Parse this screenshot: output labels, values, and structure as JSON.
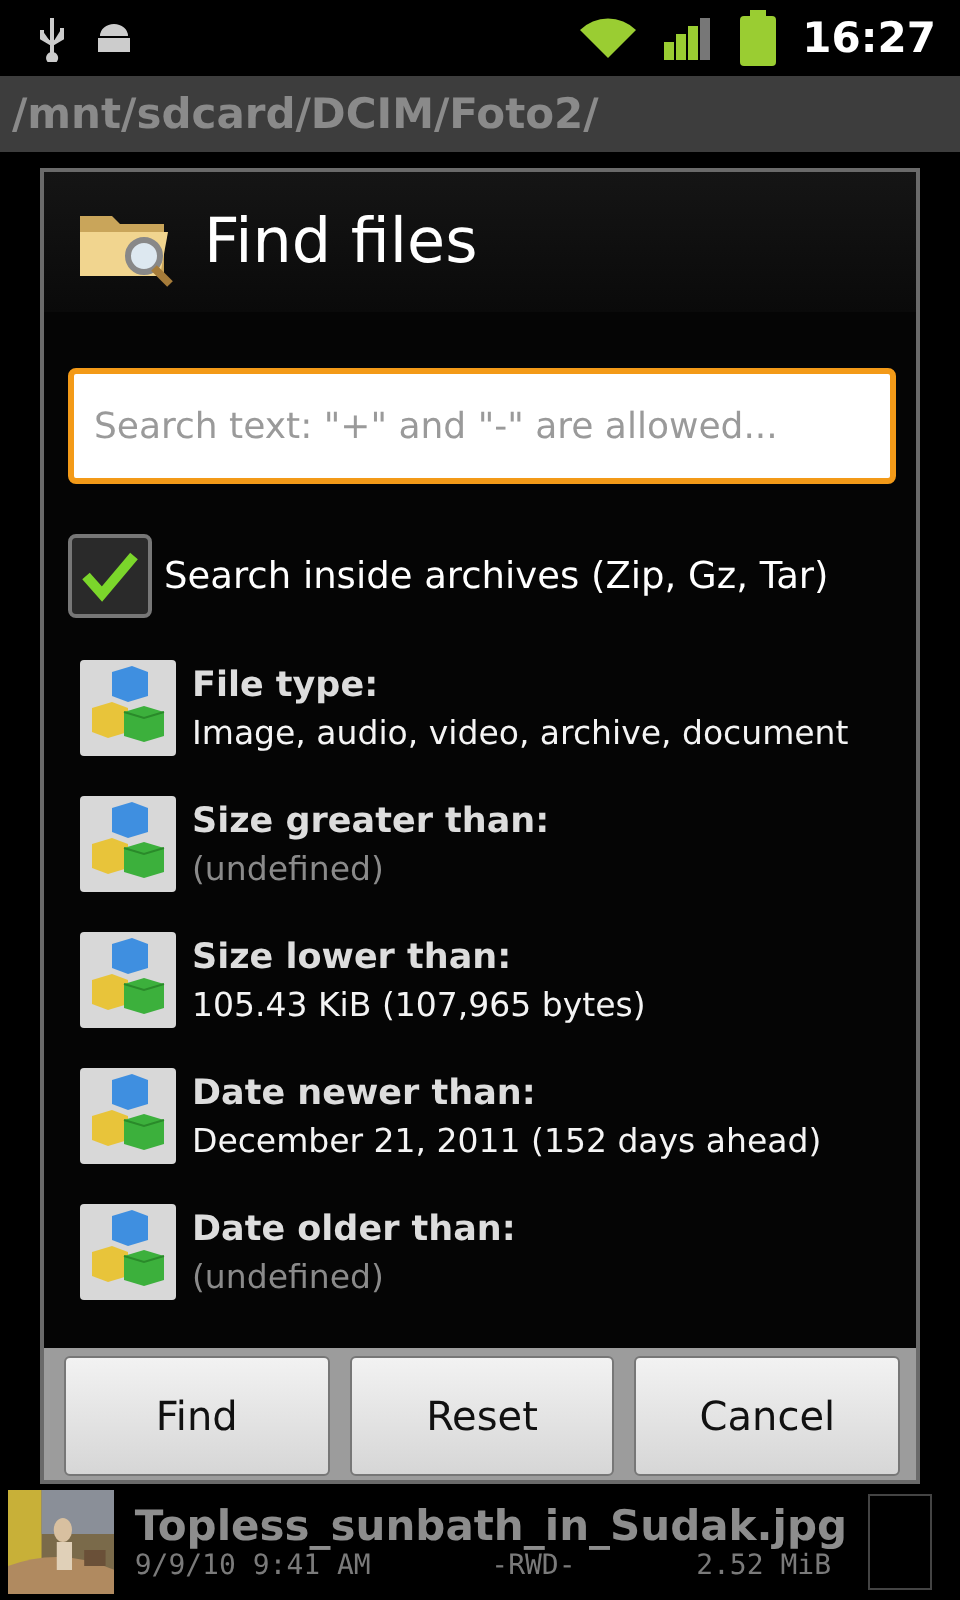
{
  "status_bar": {
    "time": "16:27"
  },
  "path": "/mnt/sdcard/DCIM/Foto2/",
  "dialog": {
    "title": "Find files",
    "search": {
      "placeholder": "Search text: \"+\" and \"-\" are allowed..."
    },
    "archives": {
      "label": "Search inside archives (Zip, Gz, Tar)",
      "checked": true
    },
    "criteria": [
      {
        "label": "File type:",
        "value": "Image, audio, video, archive, document",
        "defined": true
      },
      {
        "label": "Size greater than:",
        "value": "(undefined)",
        "defined": false
      },
      {
        "label": "Size lower than:",
        "value": "105.43 KiB (107,965 bytes)",
        "defined": true
      },
      {
        "label": "Date newer than:",
        "value": "December 21, 2011 (152 days ahead)",
        "defined": true
      },
      {
        "label": "Date older than:",
        "value": "(undefined)",
        "defined": false
      }
    ],
    "buttons": [
      "Find",
      "Reset",
      "Cancel"
    ]
  },
  "files": [
    {
      "name": "Topless_sunbath_in_Sudak.jpg",
      "date": "9/9/10 9:41 AM",
      "attributes": "-RWD-",
      "size": "2.52 MiB",
      "checked": false
    }
  ]
}
